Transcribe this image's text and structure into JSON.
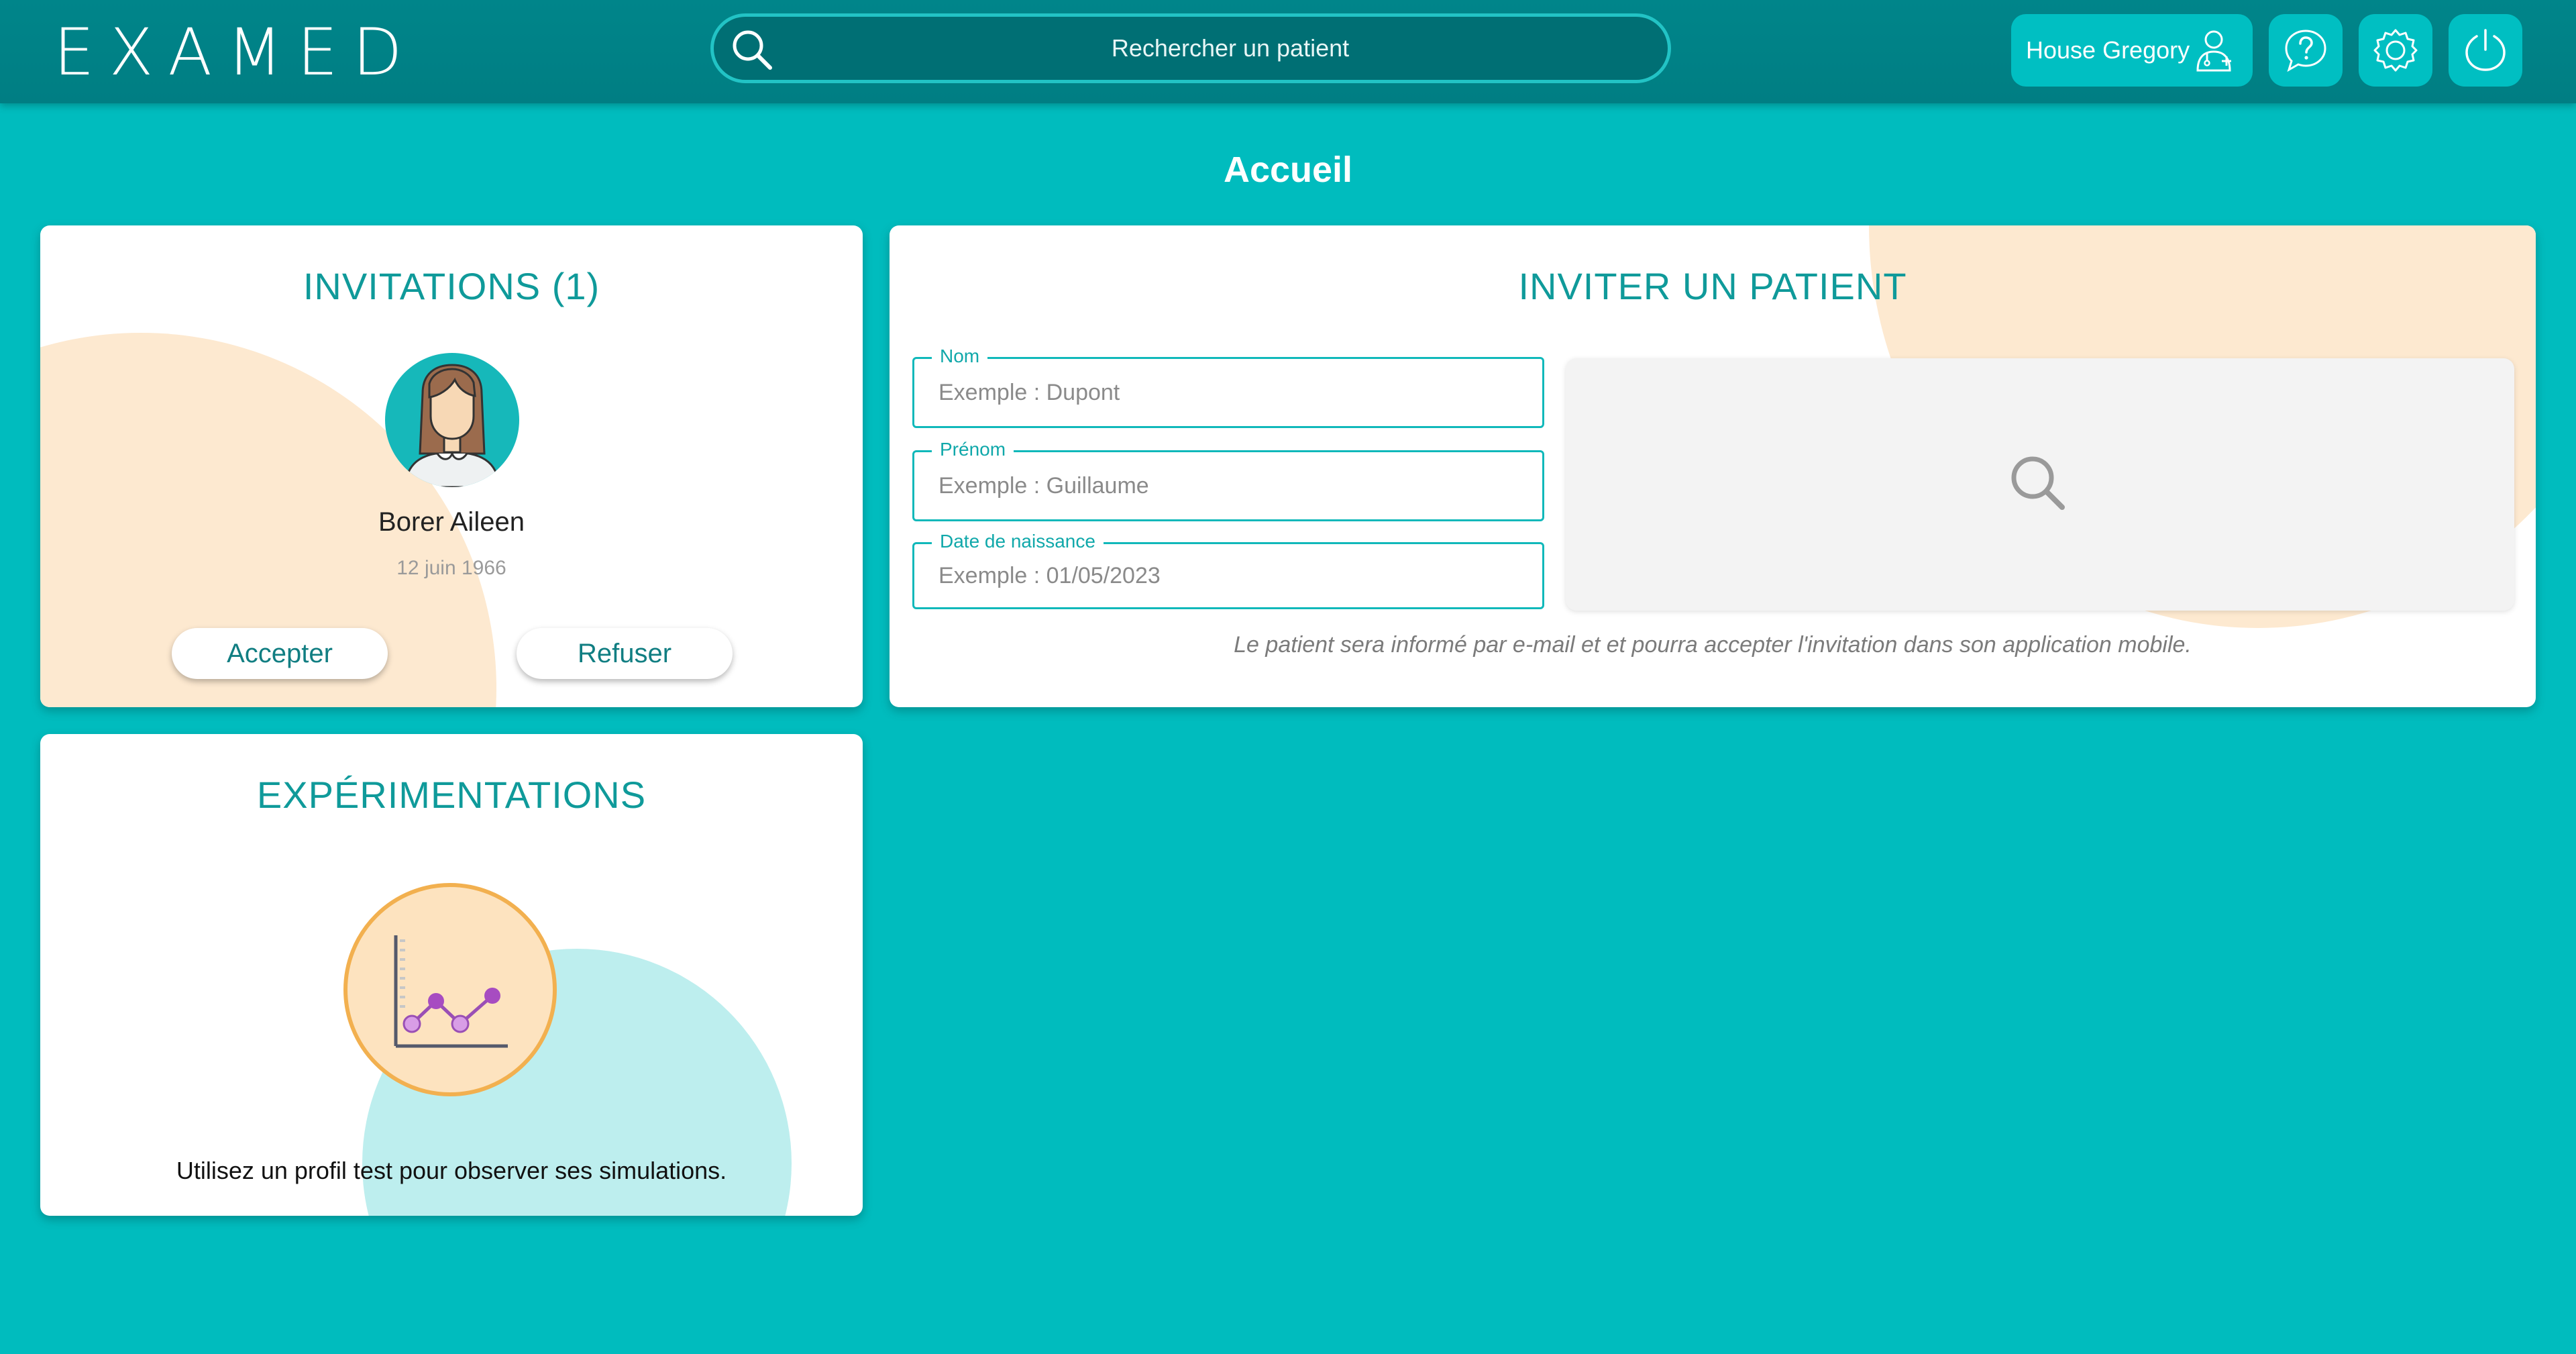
{
  "app": {
    "logo": "EXAMED"
  },
  "header": {
    "search_placeholder": "Rechercher un patient",
    "user_name": "House Gregory"
  },
  "page": {
    "title": "Accueil"
  },
  "invitations": {
    "title": "INVITATIONS (1)",
    "items": [
      {
        "name": "Borer Aileen",
        "birth_date": "12 juin 1966"
      }
    ],
    "accept_label": "Accepter",
    "refuse_label": "Refuser"
  },
  "invite_patient": {
    "title": "INVITER UN PATIENT",
    "fields": {
      "nom": {
        "label": "Nom",
        "placeholder": "Exemple : Dupont",
        "value": ""
      },
      "prenom": {
        "label": "Prénom",
        "placeholder": "Exemple : Guillaume",
        "value": ""
      },
      "date": {
        "label": "Date de naissance",
        "placeholder": "Exemple : 01/05/2023",
        "value": ""
      }
    },
    "note": "Le patient sera informé par e-mail et et pourra accepter l'invitation dans son application mobile."
  },
  "experimentations": {
    "title": "EXPÉRIMENTATIONS",
    "text": "Utilisez un profil test pour observer ses simulations."
  },
  "colors": {
    "background": "#00bcbe",
    "header": "#007e83",
    "accent": "#0f9a9a",
    "peach": "#fde9d0",
    "light_cyan": "#bdeeee"
  },
  "icons": [
    "search-icon",
    "user-doctor-icon",
    "help-icon",
    "settings-icon",
    "power-icon",
    "avatar-icon",
    "chart-icon"
  ]
}
